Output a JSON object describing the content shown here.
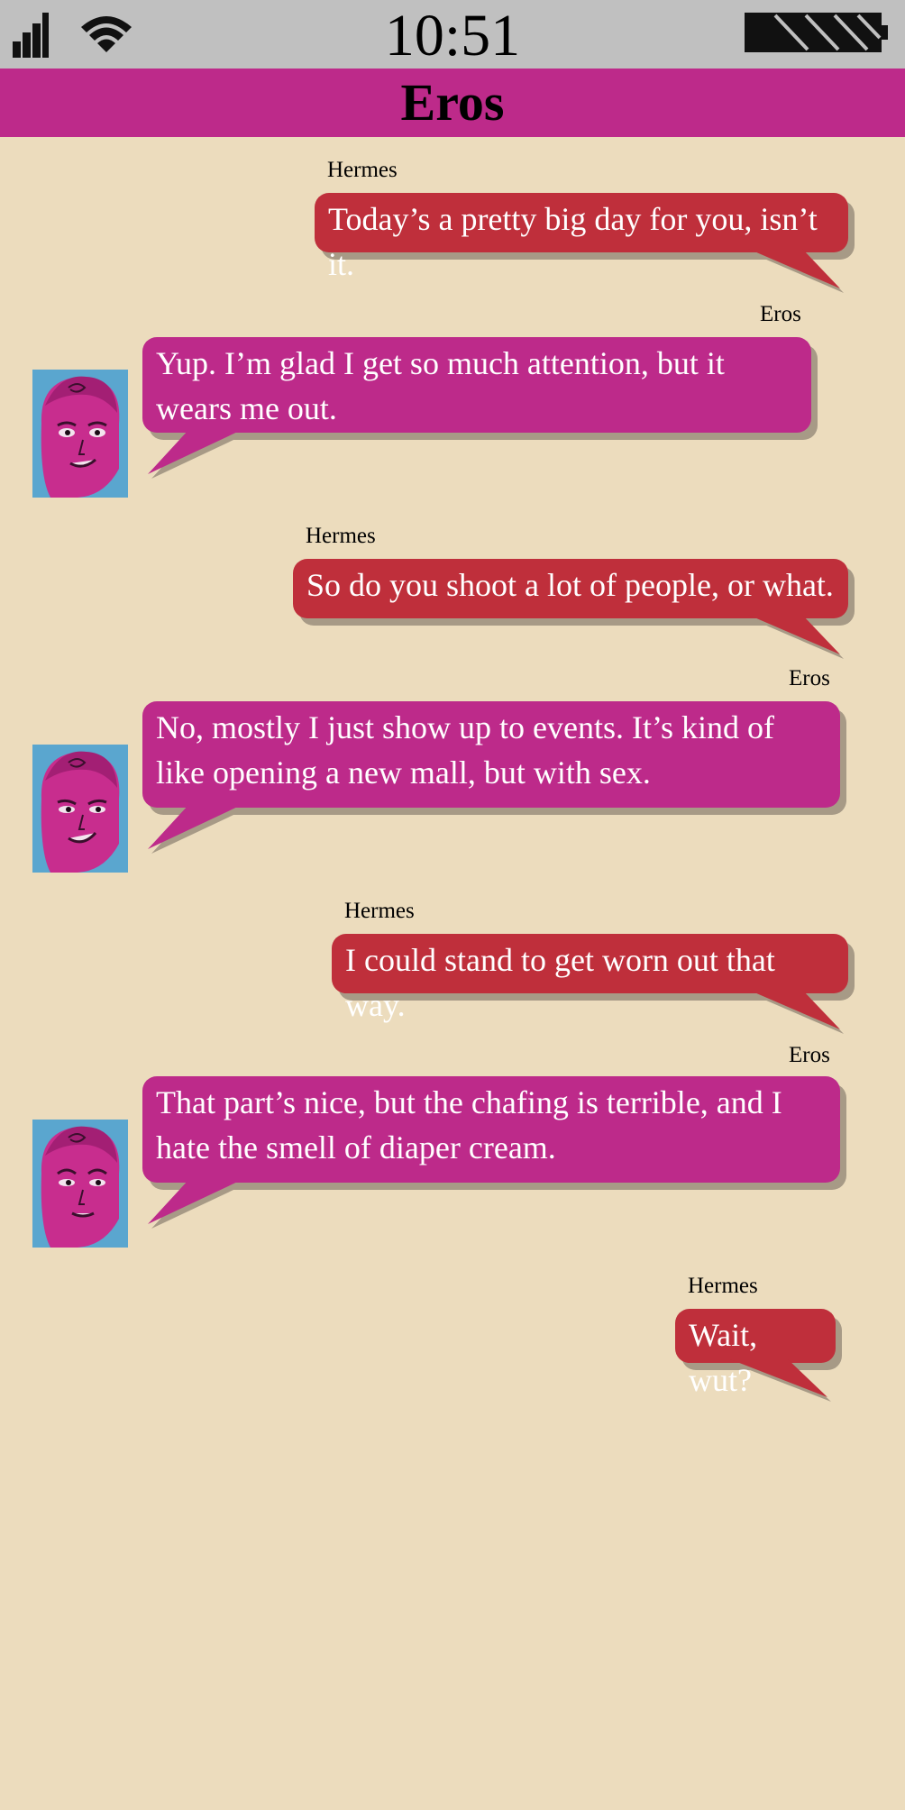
{
  "status_bar": {
    "time": "10:51",
    "icons": [
      "signal-strength-icon",
      "wifi-icon",
      "battery-icon"
    ]
  },
  "header": {
    "title": "Eros"
  },
  "colors": {
    "background": "#ecdcbd",
    "header": "#bd2a8a",
    "status_bar": "#c0c0c0",
    "hermes_bubble": "#bf2f3b",
    "eros_bubble": "#bd2a8a",
    "bubble_shadow": "#a79a86"
  },
  "messages": [
    {
      "sender": "Hermes",
      "text": "Today’s a pretty big day for you, isn’t it."
    },
    {
      "sender": "Eros",
      "text": "Yup. I’m glad I get so much attention, but it wears me out."
    },
    {
      "sender": "Hermes",
      "text": "So do you shoot a lot of people, or what."
    },
    {
      "sender": "Eros",
      "text": "No, mostly I just show up to events. It’s kind of like opening a new mall, but with sex."
    },
    {
      "sender": "Hermes",
      "text": "I could stand to get worn out that way."
    },
    {
      "sender": "Eros",
      "text": "That part’s nice, but the chafing is terrible, and I hate the smell of diaper cream."
    },
    {
      "sender": "Hermes",
      "text": "Wait, wut?"
    }
  ]
}
